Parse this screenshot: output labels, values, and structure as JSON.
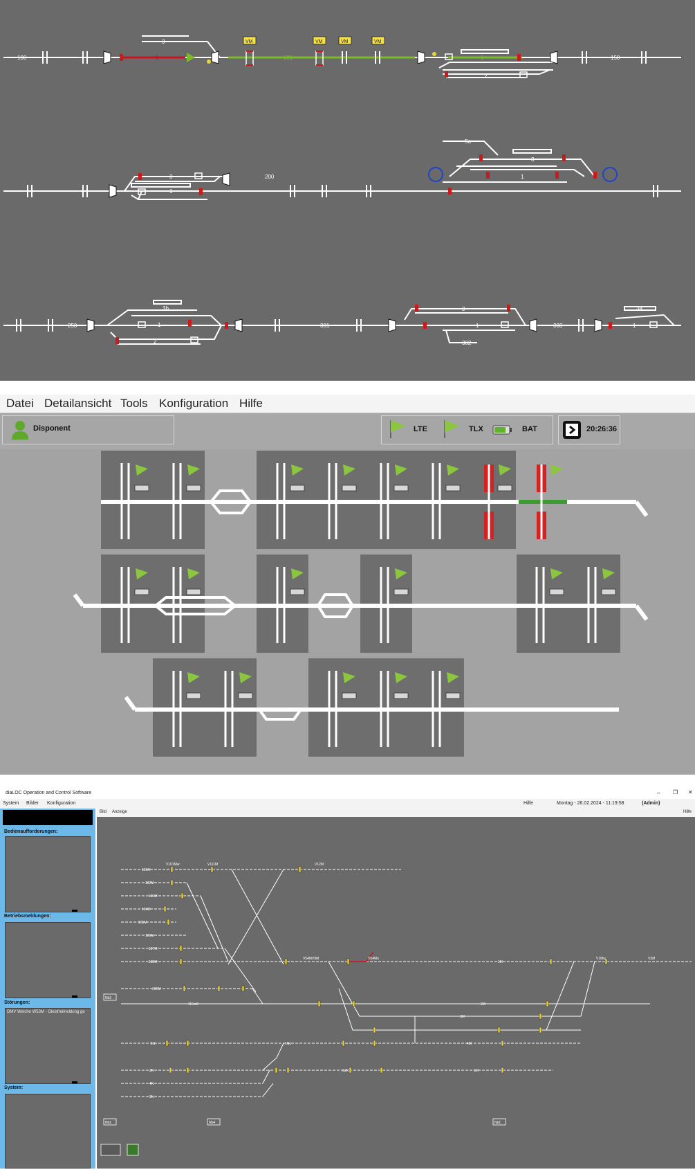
{
  "panel1": {
    "track_labels": [
      "100",
      "3",
      "1",
      "181",
      "2",
      "1",
      "150"
    ],
    "vm_labels": [
      "VM",
      "VM",
      "VM",
      "VM"
    ],
    "row2_labels": [
      "3",
      "1",
      "200",
      "5a",
      "3",
      "1"
    ],
    "row3_labels": [
      "3b",
      "1",
      "2",
      "250",
      "301",
      "3",
      "1",
      "302",
      "303",
      "3a",
      "1"
    ]
  },
  "panel2": {
    "menu": [
      "Datei",
      "Detailansicht",
      "Tools",
      "Konfiguration",
      "Hilfe"
    ],
    "user": "Disponent",
    "status": [
      "LTE",
      "TLX",
      "BAT"
    ],
    "time": "20:26:36"
  },
  "panel3": {
    "window_title": "diaLOC Operation and Control Software",
    "menu": [
      "System",
      "Bilder",
      "Konfiguration"
    ],
    "help": "Hilfe",
    "datetime": "Montag - 26.02.2024 - 11:19:58",
    "user": "(Admin)",
    "submenu": [
      "Bild",
      "Anzeige"
    ],
    "submenu_help": "Hilfe",
    "sections": [
      "Bedienaufforderungen:",
      "Betriebsmeldungen:",
      "Störungen:",
      "System:"
    ],
    "stoerung_text": "DMV Weiche W53M - Gleisfreimeldung ge",
    "tracks_left": [
      "101M",
      "102M",
      "103M",
      "104M",
      "105M",
      "106M",
      "107M",
      "108M",
      "109M",
      "115aM",
      "1N",
      "3N",
      "4N",
      "5N"
    ],
    "signals": [
      "V101Mw",
      "V111M",
      "V12M",
      "V102Mw",
      "V103Mw",
      "V104Mw",
      "V105Mw",
      "V106Mw",
      "V107Mw",
      "V6M",
      "V108Mw",
      "V54MV9M",
      "V54Mo",
      "V1Mw",
      "V2M",
      "V109Mw",
      "V116M",
      "V114M",
      "V51Mw",
      "V2Mo",
      "V2Mw",
      "V3Mo",
      "V3Mw",
      "V5M",
      "V1Nw",
      "V1No",
      "V11N",
      "V4Mo",
      "V4Mw",
      "V3Nw",
      "V3No",
      "V13-1",
      "V14No",
      "V2Nw",
      "V5Mo",
      "V5Mw",
      "V4Nw",
      "V4No",
      "V5Nw",
      "V5No"
    ],
    "track_mid": [
      "1M",
      "2M",
      "3M",
      "4M",
      "5M",
      "1No",
      "3No",
      "4No",
      "5No",
      "3aN"
    ],
    "boxes": [
      "Nb3",
      "Nb2",
      "Nb4",
      "Nb1"
    ],
    "window_controls": [
      "–",
      "❐",
      "✕"
    ]
  }
}
